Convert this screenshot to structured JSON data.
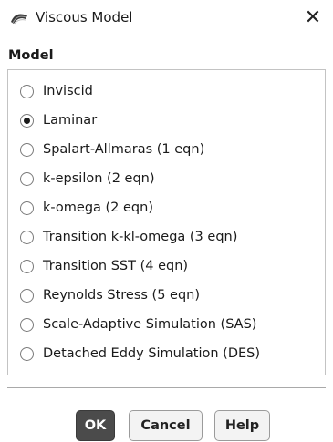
{
  "window": {
    "title": "Viscous Model",
    "close_glyph": "✕"
  },
  "model": {
    "label": "Model",
    "selected": "Laminar",
    "options": [
      {
        "label": "Inviscid",
        "checked": false
      },
      {
        "label": "Laminar",
        "checked": true
      },
      {
        "label": "Spalart-Allmaras (1 eqn)",
        "checked": false
      },
      {
        "label": "k-epsilon (2 eqn)",
        "checked": false
      },
      {
        "label": "k-omega (2 eqn)",
        "checked": false
      },
      {
        "label": "Transition k-kl-omega (3 eqn)",
        "checked": false
      },
      {
        "label": "Transition SST (4 eqn)",
        "checked": false
      },
      {
        "label": "Reynolds Stress (5 eqn)",
        "checked": false
      },
      {
        "label": "Scale-Adaptive Simulation (SAS)",
        "checked": false
      },
      {
        "label": "Detached Eddy Simulation (DES)",
        "checked": false
      }
    ]
  },
  "buttons": {
    "ok": "OK",
    "cancel": "Cancel",
    "help": "Help"
  },
  "colors": {
    "primary_button": "#4b4b4b",
    "border": "#c3c3c3"
  }
}
